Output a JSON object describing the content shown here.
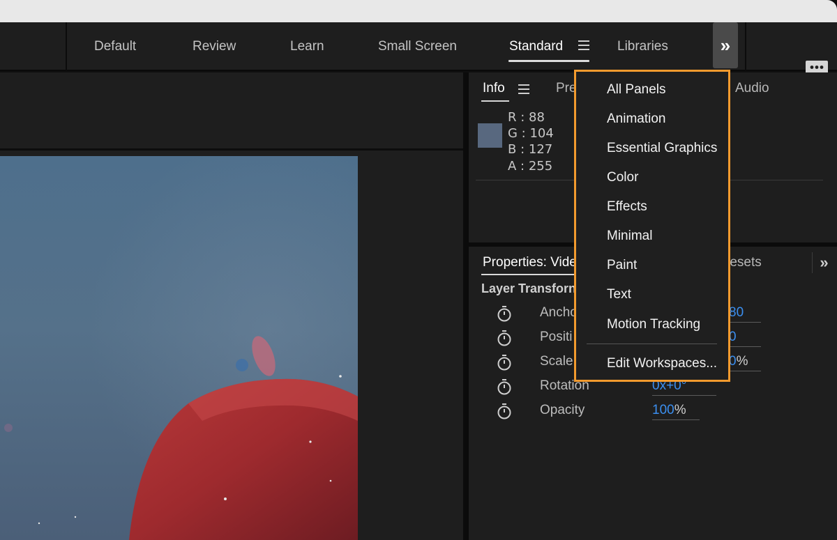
{
  "workspaces": {
    "tabs": [
      {
        "label": "Default"
      },
      {
        "label": "Review"
      },
      {
        "label": "Learn"
      },
      {
        "label": "Small Screen"
      },
      {
        "label": "Standard"
      },
      {
        "label": "Libraries"
      }
    ],
    "active": "Standard",
    "overflow_glyph": "»"
  },
  "info_panel": {
    "tab_info": "Info",
    "tab_preview_partial": "Pre",
    "tab_audio": "Audio",
    "swatch_color": "#58687f",
    "rgba": {
      "r_label": "R :",
      "r": "88",
      "g_label": "G :",
      "g": "104",
      "b_label": "B :",
      "b": "127",
      "a_label": "A :",
      "a": "255"
    }
  },
  "properties_panel": {
    "tab_properties": "Properties: Vide",
    "tab_presets_partial": "resets",
    "overflow_glyph": "»",
    "section_title": "Layer Transforn",
    "rows": [
      {
        "label": "Ancho",
        "value": "80",
        "unit": ""
      },
      {
        "label": "Positi",
        "value": "0",
        "unit": ""
      },
      {
        "label": "Scale",
        "value": "0",
        "unit": "%"
      },
      {
        "label": "Rotation",
        "value_a": "0x",
        "value_b": "+0°"
      },
      {
        "label": "Opacity",
        "value": "100",
        "unit": "%"
      }
    ]
  },
  "workspace_menu": {
    "items": [
      {
        "label": "All Panels"
      },
      {
        "label": "Animation"
      },
      {
        "label": "Essential Graphics"
      },
      {
        "label": "Color"
      },
      {
        "label": "Effects"
      },
      {
        "label": "Minimal"
      },
      {
        "label": "Paint"
      },
      {
        "label": "Text"
      },
      {
        "label": "Motion Tracking"
      }
    ],
    "edit_label": "Edit Workspaces...",
    "highlight_color": "#f29a2e"
  },
  "colors": {
    "panel_bg": "#1e1e1e",
    "value_blue": "#3b8ff0"
  }
}
